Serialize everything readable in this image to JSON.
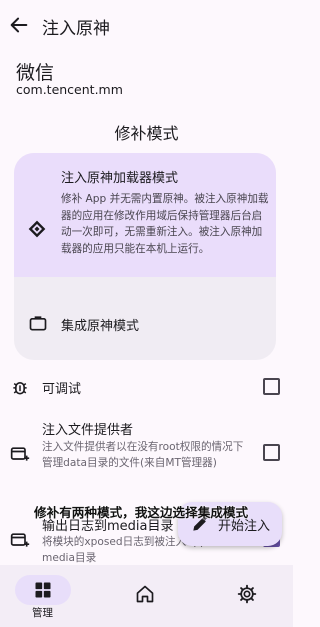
{
  "appbar": {
    "title": "注入原神",
    "back_icon": "arrow-left-icon"
  },
  "app": {
    "name": "微信",
    "package": "com.tencent.mm"
  },
  "section": {
    "title": "修补模式"
  },
  "patch_modes": {
    "selected": {
      "title": "注入原神加载器模式",
      "description": "修补 App 并无需内置原神。被注入原神加载器的应用在修改作用域后保持管理器后台启动一次即可，无需重新注入。被注入原神加载器的应用只能在本机上运行。",
      "icon": "loader-diamond-icon"
    },
    "other": {
      "title": "集成原神模式",
      "icon": "briefcase-icon"
    }
  },
  "options": [
    {
      "title": "可调试",
      "description": "",
      "icon": "bug-icon",
      "checked": false
    },
    {
      "title": "注入文件提供者",
      "description": "注入文件提供者以在没有root权限的情况下管理data目录的文件(来自MT管理器)",
      "icon": "add-card-icon",
      "checked": false
    },
    {
      "title": "输出日志到media目录",
      "description": "将模块的xposed日志到被注入App的media目录",
      "icon": "add-card-icon",
      "checked": true
    }
  ],
  "fab": {
    "label": "开始注入",
    "icon": "edit-pen-icon"
  },
  "overlay_caption": "修补有两种模式，我这边选择集成模式",
  "bottom_nav": {
    "items": [
      {
        "label": "管理",
        "icon": "grid-icon",
        "active": true
      },
      {
        "label": "",
        "icon": "home-icon",
        "active": false
      },
      {
        "label": "",
        "icon": "gear-icon",
        "active": false
      }
    ]
  },
  "colors": {
    "accent": "#6750a4",
    "selected_container": "#eaddfb",
    "surface": "#fdf8fd"
  }
}
